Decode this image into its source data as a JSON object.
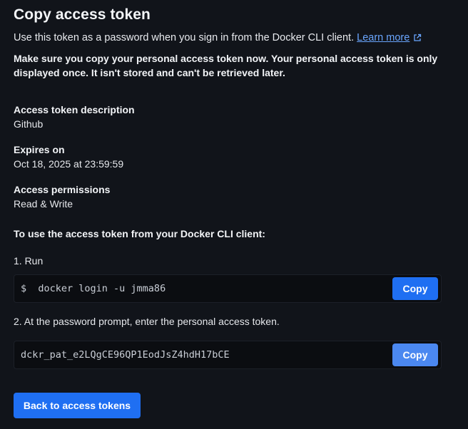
{
  "dialog": {
    "title": "Copy access token",
    "subtitle": "Use this token as a password when you sign in from the Docker CLI client.",
    "learn_more": "Learn more",
    "warning": "Make sure you copy your personal access token now. Your personal access token is only displayed once. It isn't stored and can't be retrieved later."
  },
  "fields": {
    "description_label": "Access token description",
    "description_value": "Github",
    "expires_label": "Expires on",
    "expires_value": "Oct 18, 2025 at 23:59:59",
    "permissions_label": "Access permissions",
    "permissions_value": "Read & Write"
  },
  "instructions": {
    "heading": "To use the access token from your Docker CLI client:",
    "step1": "1. Run",
    "login_command": "$  docker login -u jmma86",
    "step2": "2. At the password prompt, enter the personal access token.",
    "token": "dckr_pat_e2LQgCE96QP1EodJsZ4hdH17bCE",
    "copy_label": "Copy"
  },
  "actions": {
    "back_label": "Back to access tokens"
  },
  "colors": {
    "background": "#11141a",
    "accent": "#1f6ff2",
    "link": "#6aa6ff"
  }
}
